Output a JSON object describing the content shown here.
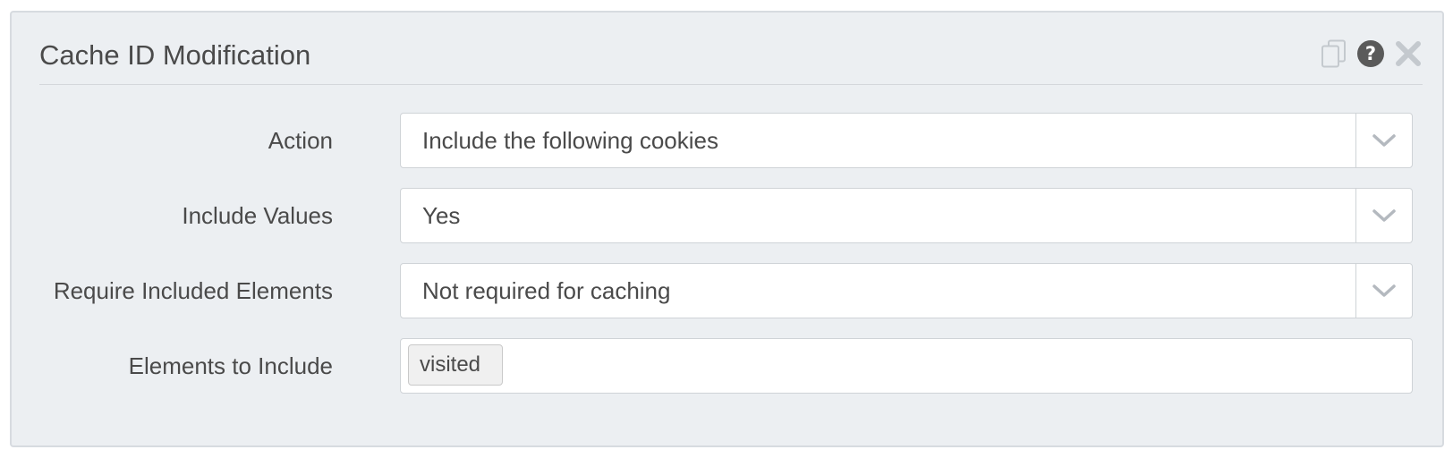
{
  "panel": {
    "title": "Cache ID Modification",
    "icons": [
      "copy-icon",
      "help-icon",
      "close-icon"
    ]
  },
  "fields": {
    "action": {
      "label": "Action",
      "value": "Include the following cookies"
    },
    "include_values": {
      "label": "Include Values",
      "value": "Yes"
    },
    "require_included": {
      "label": "Require Included Elements",
      "value": "Not required for caching"
    },
    "elements_to_include": {
      "label": "Elements to Include",
      "tags": [
        "visited"
      ]
    }
  },
  "colors": {
    "panel_bg": "#eceff2",
    "text": "#4a4a4a",
    "icon": "#c4c9ce",
    "help_icon": "#5a5a5a",
    "border": "#cfd3d7"
  }
}
